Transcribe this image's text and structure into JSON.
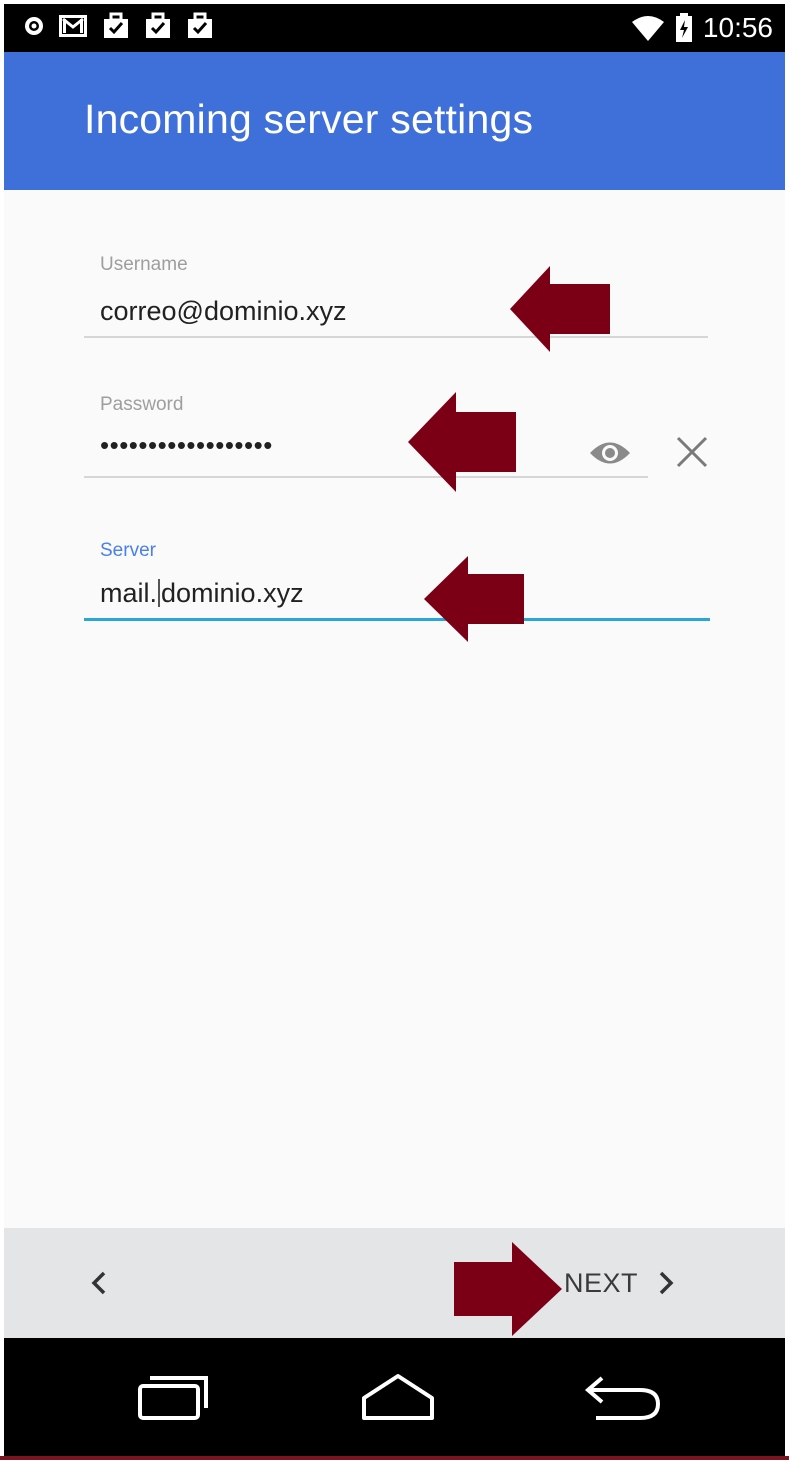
{
  "status_bar": {
    "time": "10:56",
    "left_icons": [
      "shield-icon",
      "gmail-icon",
      "briefcase-check-icon",
      "briefcase-check-icon",
      "briefcase-check-icon"
    ],
    "right_icons": [
      "wifi-icon",
      "battery-charging-icon"
    ]
  },
  "app_bar": {
    "title": "Incoming server settings",
    "color": "#3f6fd8"
  },
  "form": {
    "username": {
      "label": "Username",
      "value": "correo@dominio.xyz"
    },
    "password": {
      "label": "Password",
      "value": "••••••••••••••••••"
    },
    "server": {
      "label": "Server",
      "value_before_cursor": "mail.",
      "value_after_cursor": "dominio.xyz"
    }
  },
  "bottom_bar": {
    "prev_icon": "chevron-left-icon",
    "next_label": "NEXT",
    "next_icon": "chevron-right-icon"
  },
  "nav_bar": {
    "buttons": [
      "recents-icon",
      "home-icon",
      "back-icon"
    ]
  },
  "annotations": {
    "arrow_color": "#7b0015"
  }
}
